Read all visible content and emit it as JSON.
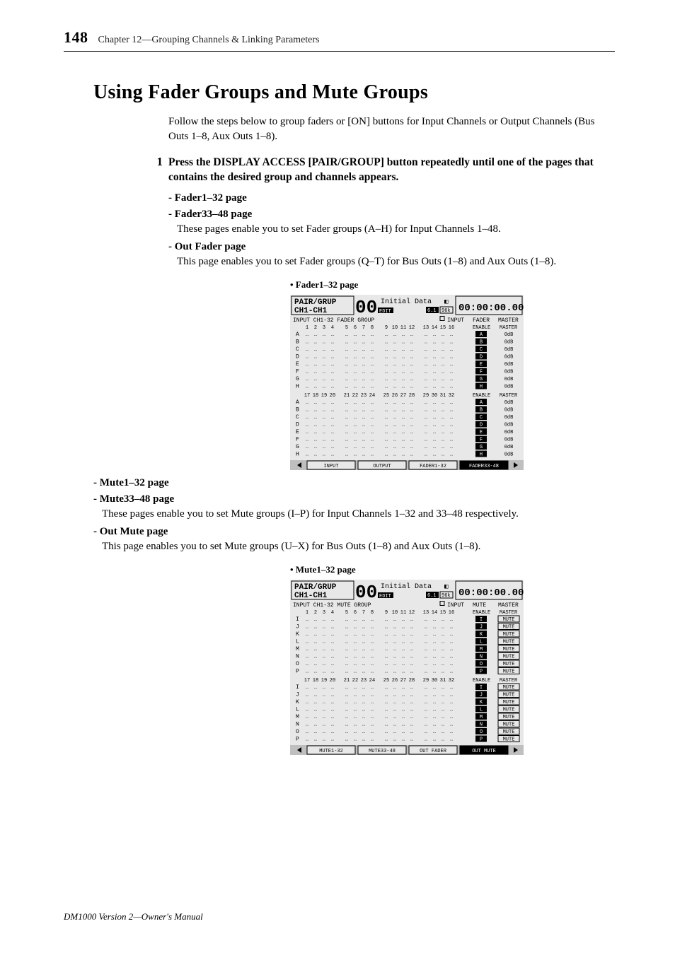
{
  "page_number": "148",
  "chapter": "Chapter 12—Grouping Channels & Linking Parameters",
  "heading": "Using Fader Groups and Mute Groups",
  "intro": "Follow the steps below to group faders or [ON] buttons for Input Channels or Output Channels (Bus Outs 1–8, Aux Outs 1–8).",
  "step_num": "1",
  "step_text": "Press the DISPLAY ACCESS [PAIR/GROUP] button repeatedly until one of the pages that contains the desired group and channels appears.",
  "bullets1": {
    "b0_head": "Fader1–32 page",
    "b1_head": "Fader33–48 page",
    "b1_body": "These pages enable you to set Fader groups (A–H) for Input Channels 1–48.",
    "b2_head": "Out Fader page",
    "b2_body": "This page enables you to set Fader groups (Q–T) for Bus Outs (1–8) and Aux Outs (1–8)."
  },
  "caption1": "• Fader1–32 page",
  "bullets2": {
    "b0_head": "Mute1–32 page",
    "b1_head": "Mute33–48 page",
    "b1_body": "These pages enable you to set Mute groups (I–P) for Input Channels 1–32 and 33–48 respectively.",
    "b2_head": "Out Mute page",
    "b2_body": "This page enables you to set Mute groups (U–X) for Bus Outs (1–8) and Aux Outs (1–8)."
  },
  "caption2": "• Mute1–32 page",
  "footer": "DM1000 Version 2—Owner's Manual",
  "screen1": {
    "title1": "PAIR/GRUP",
    "title2": "CH1-CH1",
    "bignum": "00",
    "edit": "EDIT",
    "init": "Initial Data",
    "sr": "6.1",
    "srk": "96k",
    "clock_icon": "◧",
    "clock": "00:00:00.00",
    "table_title": "INPUT CH1-32 FADER GROUP",
    "right_headers": {
      "c1": "INPUT",
      "c2": "FADER",
      "c3": "MASTER"
    },
    "cols_top": [
      "1",
      "2",
      "3",
      "4",
      "5",
      "6",
      "7",
      "8",
      "9",
      "10",
      "11",
      "12",
      "13",
      "14",
      "15",
      "16"
    ],
    "cols_bot": [
      "17",
      "18",
      "19",
      "20",
      "21",
      "22",
      "23",
      "24",
      "25",
      "26",
      "27",
      "28",
      "29",
      "30",
      "31",
      "32"
    ],
    "rows": [
      "A",
      "B",
      "C",
      "D",
      "E",
      "F",
      "G",
      "H"
    ],
    "enable": "ENABLE",
    "master_head": "MASTER",
    "master_val": "0dB",
    "tabs": [
      "INPUT",
      "OUTPUT",
      "FADER1-32",
      "FADER33-48"
    ]
  },
  "screen2": {
    "title1": "PAIR/GRUP",
    "title2": "CH1-CH1",
    "bignum": "00",
    "edit": "EDIT",
    "init": "Initial Data",
    "sr": "6.1",
    "srk": "96k",
    "clock_icon": "◧",
    "clock": "00:00:00.00",
    "table_title": "INPUT CH1-32 MUTE GROUP",
    "right_headers": {
      "c1": "INPUT",
      "c2": "MUTE",
      "c3": "MASTER"
    },
    "cols_top": [
      "1",
      "2",
      "3",
      "4",
      "5",
      "6",
      "7",
      "8",
      "9",
      "10",
      "11",
      "12",
      "13",
      "14",
      "15",
      "16"
    ],
    "cols_bot": [
      "17",
      "18",
      "19",
      "20",
      "21",
      "22",
      "23",
      "24",
      "25",
      "26",
      "27",
      "28",
      "29",
      "30",
      "31",
      "32"
    ],
    "rows": [
      "I",
      "J",
      "K",
      "L",
      "M",
      "N",
      "O",
      "P"
    ],
    "enable": "ENABLE",
    "master_head": "MASTER",
    "master_val": "MUTE",
    "tabs": [
      "MUTE1-32",
      "MUTE33-48",
      "OUT FADER",
      "OUT MUTE"
    ]
  }
}
